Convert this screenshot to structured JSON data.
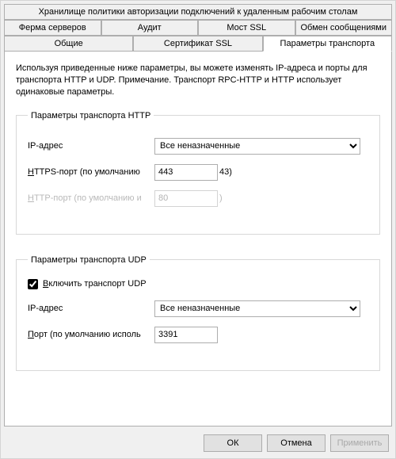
{
  "tabs": {
    "row1": [
      "Хранилище политики авторизации подключений к удаленным рабочим столам"
    ],
    "row2": [
      "Ферма серверов",
      "Аудит",
      "Мост SSL",
      "Обмен сообщениями"
    ],
    "row3": [
      "Общие",
      "Сертификат SSL",
      "Параметры транспорта"
    ]
  },
  "activeTab": "Параметры транспорта",
  "description": "Используя приведенные ниже параметры, вы можете изменять IP-адреса и порты для транспорта HTTP и UDP. Примечание. Транспорт RPC-HTTP и HTTP использует одинаковые параметры.",
  "httpGroup": {
    "legend": "Параметры транспорта HTTP",
    "ipLabel": "IP-адрес",
    "ipSelected": "Все неназначенные",
    "httpsLabelPrefix": "H",
    "httpsLabelRest": "TTPS-порт (по умолчанию",
    "httpsValue": "443",
    "httpsSuffix": "43)",
    "httpLabelPrefix": "H",
    "httpLabelRest": "TTP-порт (по умолчанию и",
    "httpValue": "80",
    "httpSuffix": ")"
  },
  "udpGroup": {
    "legend": "Параметры транспорта UDP",
    "enablePrefix": "В",
    "enableRest": "ключить транспорт UDP",
    "enableChecked": true,
    "ipLabel": "IP-адрес",
    "ipSelected": "Все неназначенные",
    "portLabelPrefix": "П",
    "portLabelRest": "орт (по умолчанию исполь",
    "portValue": "3391"
  },
  "buttons": {
    "ok": "ОК",
    "cancel": "Отмена",
    "apply": "Применить"
  }
}
